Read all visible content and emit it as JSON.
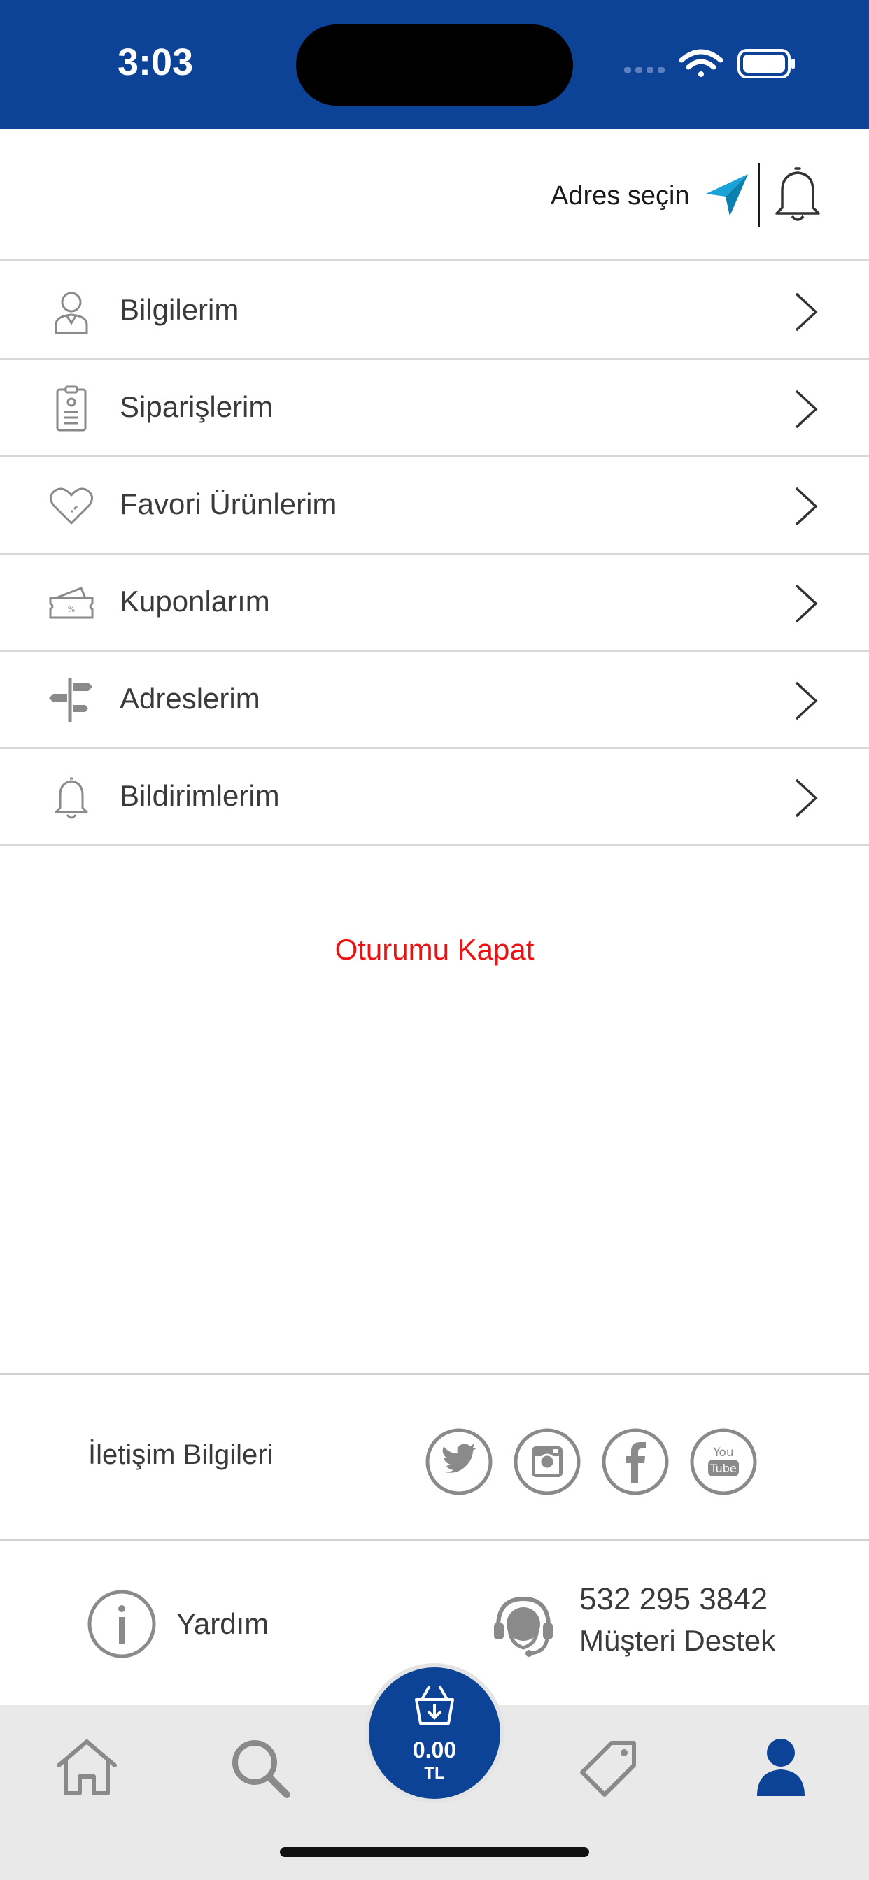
{
  "status_bar": {
    "time": "3:03"
  },
  "header": {
    "address_label": "Adres seçin"
  },
  "menu": {
    "items": [
      {
        "label": "Bilgilerim",
        "icon": "user-icon"
      },
      {
        "label": "Siparişlerim",
        "icon": "clipboard-icon"
      },
      {
        "label": "Favori Ürünlerim",
        "icon": "heart-icon"
      },
      {
        "label": "Kuponlarım",
        "icon": "coupon-icon"
      },
      {
        "label": "Adreslerim",
        "icon": "signpost-icon"
      },
      {
        "label": "Bildirimlerim",
        "icon": "bell-icon"
      }
    ]
  },
  "logout_label": "Oturumu Kapat",
  "contact": {
    "label": "İletişim Bilgileri",
    "social": [
      "twitter-icon",
      "instagram-icon",
      "facebook-icon",
      "youtube-icon"
    ]
  },
  "help": {
    "label": "Yardım"
  },
  "support": {
    "phone": "532 295 3842",
    "label": "Müşteri Destek"
  },
  "cart": {
    "amount": "0.00",
    "currency": "TL"
  },
  "tab_bar": {
    "tabs": [
      "home-icon",
      "search-icon",
      "cart-icon",
      "tag-icon",
      "profile-icon"
    ],
    "active": "profile-icon"
  },
  "colors": {
    "brand": "#0d4397",
    "accent": "#1aa3d8",
    "danger": "#ee1111",
    "icon_gray": "#8a8a8a"
  }
}
